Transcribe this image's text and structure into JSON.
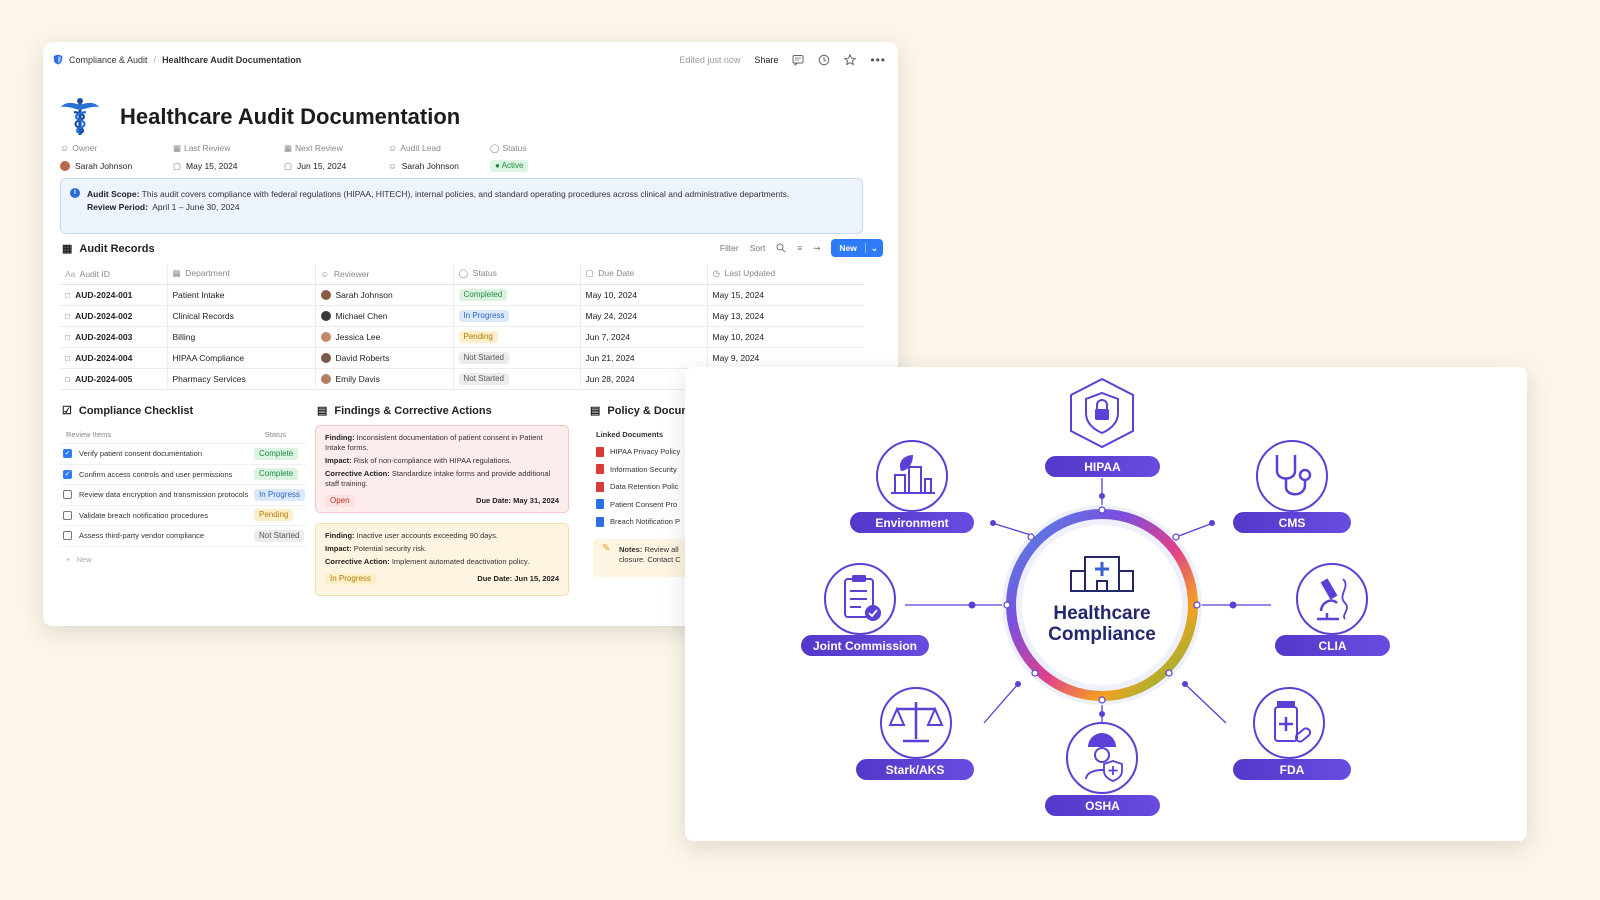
{
  "doc": {
    "breadcrumb": [
      "Compliance & Audit",
      "Healthcare Audit Documentation"
    ],
    "edited": "Edited just now",
    "share": "Share",
    "title": "Healthcare Audit Documentation",
    "props": [
      {
        "label": "Owner",
        "value": "Sarah Johnson"
      },
      {
        "label": "Last Review",
        "value": "May 15, 2024"
      },
      {
        "label": "Next Review",
        "value": "Jun 15, 2024"
      },
      {
        "label": "Audit Lead",
        "value": "Sarah Johnson"
      },
      {
        "label": "Status",
        "value": "Active"
      }
    ],
    "scope": {
      "label": "Audit Scope:",
      "text": "This audit covers compliance with federal regulations (HIPAA, HITECH), internal policies, and standard operating procedures across clinical and administrative departments.",
      "period_label": "Review Period:",
      "period": "April 1 – June 30, 2024"
    },
    "records": {
      "title": "Audit Records",
      "tools": {
        "filter": "Filter",
        "sort": "Sort",
        "new": "New"
      },
      "columns": [
        "Audit ID",
        "Department",
        "Reviewer",
        "Status",
        "Due Date",
        "Last Updated"
      ],
      "rows": [
        {
          "id": "AUD-2024-001",
          "dept": "Patient Intake",
          "reviewer": "Sarah Johnson",
          "status": "Completed",
          "due": "May 10, 2024",
          "updated": "May 15, 2024"
        },
        {
          "id": "AUD-2024-002",
          "dept": "Clinical Records",
          "reviewer": "Michael Chen",
          "status": "In Progress",
          "due": "May 24, 2024",
          "updated": "May 13, 2024"
        },
        {
          "id": "AUD-2024-003",
          "dept": "Billing",
          "reviewer": "Jessica Lee",
          "status": "Pending",
          "due": "Jun 7, 2024",
          "updated": "May 10, 2024"
        },
        {
          "id": "AUD-2024-004",
          "dept": "HIPAA Compliance",
          "reviewer": "David Roberts",
          "status": "Not Started",
          "due": "Jun 21, 2024",
          "updated": "May 9, 2024"
        },
        {
          "id": "AUD-2024-005",
          "dept": "Pharmacy Services",
          "reviewer": "Emily Davis",
          "status": "Not Started",
          "due": "Jun 28, 2024",
          "updated": ""
        }
      ]
    },
    "checklist": {
      "title": "Compliance Checklist",
      "col_items": "Review Items",
      "col_status": "Status",
      "items": [
        {
          "text": "Verify patient consent documentation",
          "status": "Complete",
          "checked": true
        },
        {
          "text": "Confirm access controls and user permissions",
          "status": "Complete",
          "checked": true
        },
        {
          "text": "Review data encryption and transmission protocols",
          "status": "In Progress",
          "checked": false
        },
        {
          "text": "Validate breach notification procedures",
          "status": "Pending",
          "checked": false
        },
        {
          "text": "Assess third-party vendor compliance",
          "status": "Not Started",
          "checked": false
        }
      ],
      "new": "New"
    },
    "findings": {
      "title": "Findings & Corrective Actions",
      "cards": [
        {
          "finding_label": "Finding:",
          "finding": "Inconsistent documentation of patient consent in Patient Intake forms.",
          "impact_label": "Impact:",
          "impact": "Risk of non-compliance with HIPAA regulations.",
          "action_label": "Corrective Action:",
          "action": "Standardize intake forms and provide additional staff training.",
          "status": "Open",
          "due": "Due Date: May 31, 2024"
        },
        {
          "finding_label": "Finding:",
          "finding": "Inactive user accounts exceeding 90 days.",
          "impact_label": "Impact:",
          "impact": "Potential security risk.",
          "action_label": "Corrective Action:",
          "action": "Implement automated deactivation policy.",
          "status": "In Progress",
          "due": "Due Date: Jun 15, 2024"
        }
      ]
    },
    "policy": {
      "title": "Policy & Docun",
      "linked": "Linked Documents",
      "docs": [
        "HIPAA Privacy Policy",
        "Information Security",
        "Data Retention Polic",
        "Patient Consent Pro",
        "Breach Notification P"
      ],
      "notes_label": "Notes:",
      "notes": "Review all",
      "notes2": "closure. Contact C"
    }
  },
  "graphic": {
    "center": [
      "Healthcare",
      "Compliance"
    ],
    "nodes": [
      "HIPAA",
      "CMS",
      "CLIA",
      "FDA",
      "OSHA",
      "Stark/AKS",
      "Joint Commission",
      "Environment"
    ],
    "colors": {
      "purple": "#5b3fd6",
      "navy": "#23286b"
    }
  }
}
